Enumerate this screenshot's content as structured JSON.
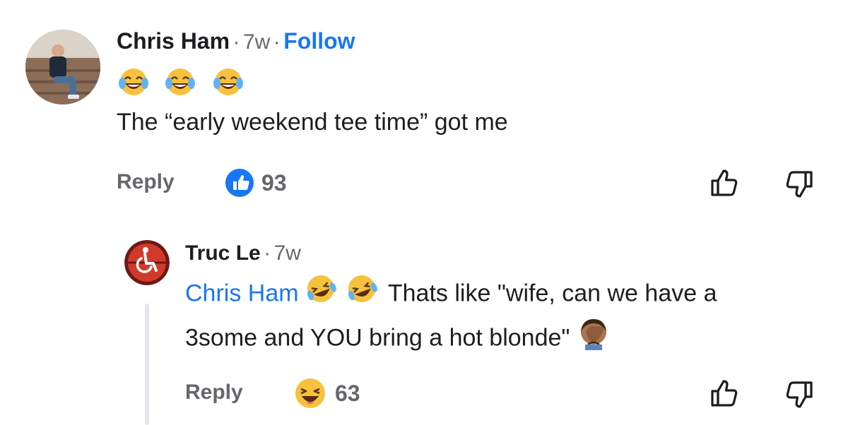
{
  "comment": {
    "author": "Chris Ham",
    "dot1": "·",
    "time": "7w",
    "dot2": "·",
    "follow_label": "Follow",
    "emojis": [
      "laughing-with-tears",
      "laughing-with-tears",
      "laughing-with-tears"
    ],
    "text": "The “early weekend tee time” got me",
    "reply_label": "Reply",
    "reaction": "like",
    "reaction_count": "93"
  },
  "reply": {
    "author": "Truc Le",
    "dot1": "·",
    "time": "7w",
    "mention": "Chris Ham",
    "text_line1": "Thats like \"wife, can we have a",
    "text_line2": "3some and YOU bring a hot blonde\"",
    "reply_label": "Reply",
    "reaction": "haha",
    "reaction_count": "63"
  },
  "colors": {
    "accent": "#1877f2",
    "muted": "#65676b",
    "text": "#1c1e21",
    "thread_line": "#e4e6eb"
  }
}
